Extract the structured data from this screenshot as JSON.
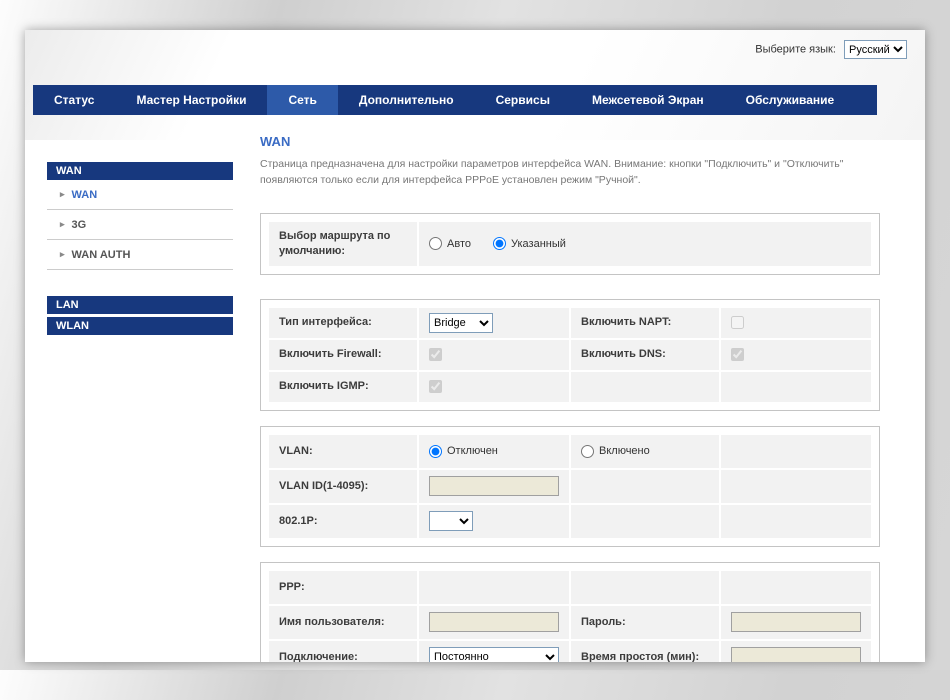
{
  "colors": {
    "navy": "#17387e",
    "nav_active": "#2d5aa9",
    "link_blue": "#3a6bc4"
  },
  "language_bar": {
    "label": "Выберите язык:",
    "selected": "Русский"
  },
  "nav": {
    "items": [
      {
        "label": "Статус",
        "active": false
      },
      {
        "label": "Мастер Настройки",
        "active": false
      },
      {
        "label": "Сеть",
        "active": true
      },
      {
        "label": "Дополнительно",
        "active": false
      },
      {
        "label": "Сервисы",
        "active": false
      },
      {
        "label": "Межсетевой Экран",
        "active": false
      },
      {
        "label": "Обслуживание",
        "active": false
      }
    ]
  },
  "sidebar": {
    "groups": [
      {
        "header": "WAN",
        "items": [
          {
            "label": "WAN",
            "active": true
          },
          {
            "label": "3G",
            "active": false
          },
          {
            "label": "WAN AUTH",
            "active": false
          }
        ]
      },
      {
        "header": "LAN"
      },
      {
        "header": "WLAN"
      }
    ]
  },
  "main": {
    "title": "WAN",
    "description": "Страница предназначена для настройки параметров интерфейса WAN. Внимание: кнопки \"Подключить\" и \"Отключить\" появляются только если для интерфейса PPPoE установлен режим \"Ручной\".",
    "route": {
      "label": "Выбор маршрута по умолчанию:",
      "auto": {
        "label": "Авто",
        "checked": false
      },
      "specified": {
        "label": "Указанный",
        "checked": true
      }
    },
    "iface": {
      "type_label": "Тип интерфейса:",
      "type_value": "Bridge",
      "napt": {
        "label": "Включить NAPT:",
        "checked": false
      },
      "firewall": {
        "label": "Включить Firewall:",
        "checked": true
      },
      "dns": {
        "label": "Включить DNS:",
        "checked": true
      },
      "igmp": {
        "label": "Включить IGMP:",
        "checked": true
      }
    },
    "vlan": {
      "label": "VLAN:",
      "off": {
        "label": "Отключен",
        "checked": true
      },
      "on": {
        "label": "Включено",
        "checked": false
      },
      "id_label": "VLAN ID(1-4095):",
      "id_value": "",
      "priority_label": "802.1P:"
    },
    "ppp": {
      "label": "PPP:",
      "username_label": "Имя пользователя:",
      "username_value": "",
      "password_label": "Пароль:",
      "password_value": "",
      "connection_label": "Подключение:",
      "connection_value": "Постоянно",
      "idle_label": "Время простоя (мин):",
      "idle_value": ""
    }
  }
}
